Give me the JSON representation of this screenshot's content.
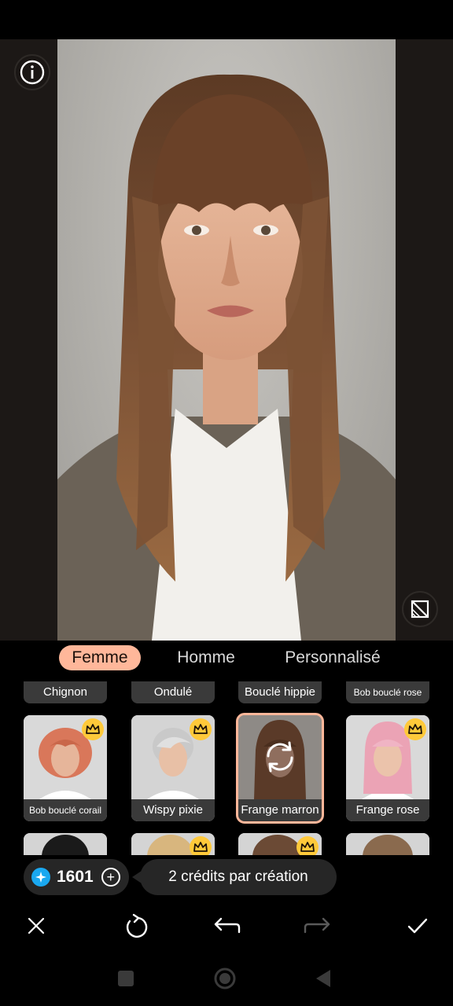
{
  "category_tabs": [
    {
      "label": "Femme",
      "active": true
    },
    {
      "label": "Homme",
      "active": false
    },
    {
      "label": "Personnalisé",
      "active": false
    }
  ],
  "top_row_labels": [
    "Chignon",
    "Ondulé",
    "Bouclé hippie",
    "Bob bouclé rose"
  ],
  "styles": [
    {
      "label": "Bob bouclé corail",
      "premium": true,
      "selected": false,
      "hair_color": "#d9775a"
    },
    {
      "label": "Wispy pixie",
      "premium": true,
      "selected": false,
      "hair_color": "#c9c9c9"
    },
    {
      "label": "Frange marron",
      "premium": false,
      "selected": true,
      "hair_color": "#5a3a28"
    },
    {
      "label": "Frange rose",
      "premium": true,
      "selected": false,
      "hair_color": "#eba3b5"
    }
  ],
  "next_row": [
    {
      "premium": false,
      "hair_color": "#1a1a1a"
    },
    {
      "premium": true,
      "hair_color": "#d8b67e"
    },
    {
      "premium": true,
      "hair_color": "#6b4a35"
    },
    {
      "premium": false,
      "hair_color": "#8a6a4e"
    }
  ],
  "credits": {
    "count": "1601"
  },
  "tooltip": {
    "text": "2 crédits par création"
  },
  "colors": {
    "accent": "#ffb79a",
    "crown": "#ffc93a",
    "gem": "#1aa8f0"
  },
  "icons": {
    "info": "info-icon",
    "compare": "compare-icon",
    "close": "close-icon",
    "regenerate": "refresh-icon",
    "undo": "undo-icon",
    "redo": "redo-icon",
    "confirm": "check-icon"
  }
}
